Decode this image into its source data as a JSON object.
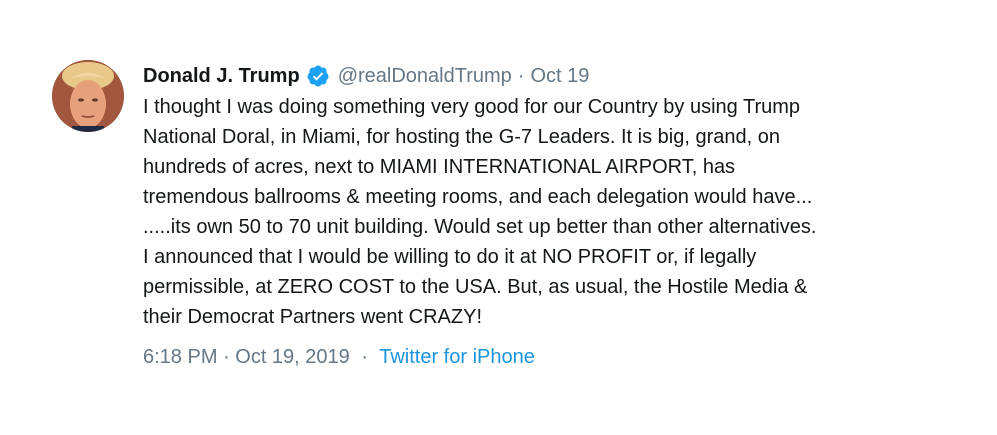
{
  "tweet": {
    "author_name": "Donald J. Trump",
    "handle": "@realDonaldTrump",
    "separator": "·",
    "date_short": "Oct 19",
    "text_lines": [
      "I thought I was doing something very good for our Country by using Trump",
      "National Doral, in Miami, for hosting the G-7 Leaders. It is big, grand, on",
      "hundreds of acres, next to MIAMI INTERNATIONAL AIRPORT, has",
      "tremendous ballrooms & meeting rooms, and each delegation would have...",
      ".....its own 50 to 70 unit building. Would set up better than other alternatives.",
      "I announced that I would be willing to do it at NO PROFIT or, if legally",
      "permissible, at ZERO COST to the USA. But, as usual, the Hostile Media &",
      "their Democrat Partners went CRAZY!"
    ],
    "timestamp": "6:18 PM · Oct 19, 2019",
    "footer_separator": "·",
    "source": "Twitter for iPhone"
  },
  "icons": {
    "verified": "verified-badge-icon",
    "avatar": "avatar"
  },
  "colors": {
    "text": "#14171a",
    "secondary": "#657786",
    "link": "#1b95e0",
    "verified": "#1da1f2"
  }
}
